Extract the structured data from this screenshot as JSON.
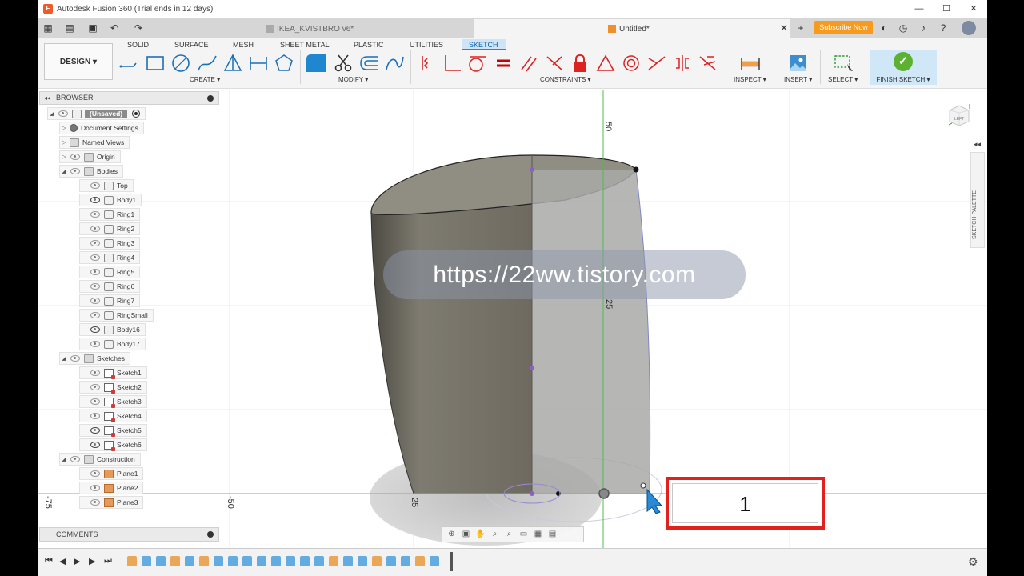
{
  "window": {
    "title": "Autodesk Fusion 360 (Trial ends in 12 days)",
    "controls": [
      "—",
      "☐",
      "✕"
    ]
  },
  "tabs": {
    "doc1": "IKEA_KVISTBRO v6*",
    "doc2": "Untitled*",
    "subscribe": "Subscribe Now"
  },
  "toolbar": {
    "design": "DESIGN ▾",
    "workspaces": [
      "SOLID",
      "SURFACE",
      "MESH",
      "SHEET METAL",
      "PLASTIC",
      "UTILITIES",
      "SKETCH"
    ],
    "groups": {
      "create": "CREATE ▾",
      "modify": "MODIFY ▾",
      "constraints": "CONSTRAINTS ▾",
      "inspect": "INSPECT ▾",
      "insert": "INSERT ▾",
      "select": "SELECT ▾",
      "finish": "FINISH SKETCH ▾"
    },
    "accent": "#0696d7"
  },
  "browser": {
    "title": "BROWSER",
    "items": [
      {
        "label": "(Unsaved)"
      },
      {
        "label": "Document Settings"
      },
      {
        "label": "Named Views"
      },
      {
        "label": "Origin"
      },
      {
        "label": "Bodies"
      },
      {
        "label": "Top"
      },
      {
        "label": "Body1"
      },
      {
        "label": "Ring1"
      },
      {
        "label": "Ring2"
      },
      {
        "label": "Ring3"
      },
      {
        "label": "Ring4"
      },
      {
        "label": "Ring5"
      },
      {
        "label": "Ring6"
      },
      {
        "label": "Ring7"
      },
      {
        "label": "RingSmall"
      },
      {
        "label": "Body16"
      },
      {
        "label": "Body17"
      },
      {
        "label": "Sketches"
      },
      {
        "label": "Sketch1"
      },
      {
        "label": "Sketch2"
      },
      {
        "label": "Sketch3"
      },
      {
        "label": "Sketch4"
      },
      {
        "label": "Sketch5"
      },
      {
        "label": "Sketch6"
      },
      {
        "label": "Construction"
      },
      {
        "label": "Plane1"
      },
      {
        "label": "Plane2"
      },
      {
        "label": "Plane3"
      }
    ]
  },
  "comments": {
    "title": "COMMENTS"
  },
  "viewport": {
    "axis_labels": [
      "50",
      "25",
      "-75",
      "-50",
      "25"
    ],
    "viewcube_face": "LEFT",
    "sketch_palette": "SKETCH PALETTE",
    "watermark": "https://22ww.tistory.com",
    "value_input": "1"
  }
}
